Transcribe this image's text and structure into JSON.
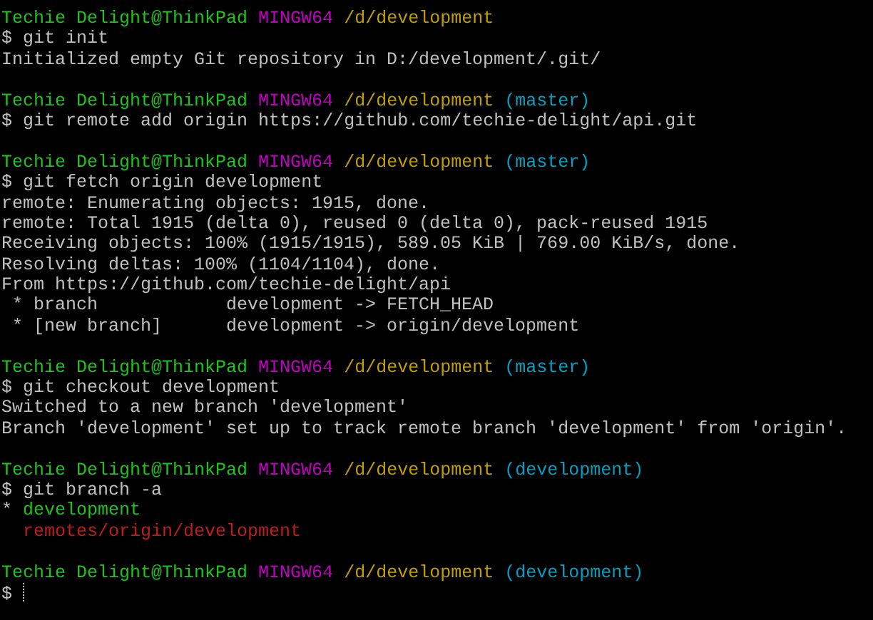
{
  "terminal": {
    "lines": [
      {
        "kind": "prompt",
        "user": "Techie Delight@ThinkPad",
        "shell": "MINGW64",
        "path": "/d/development"
      },
      {
        "kind": "command",
        "symbol": "$",
        "text": "git init"
      },
      {
        "kind": "output",
        "segments": [
          {
            "text": "Initialized empty Git repository in D:/development/.git/",
            "color": "#c0c0c0"
          }
        ]
      },
      {
        "kind": "blank"
      },
      {
        "kind": "prompt",
        "user": "Techie Delight@ThinkPad",
        "shell": "MINGW64",
        "path": "/d/development",
        "branch": "(master)"
      },
      {
        "kind": "command",
        "symbol": "$",
        "text": "git remote add origin https://github.com/techie-delight/api.git"
      },
      {
        "kind": "blank"
      },
      {
        "kind": "prompt",
        "user": "Techie Delight@ThinkPad",
        "shell": "MINGW64",
        "path": "/d/development",
        "branch": "(master)"
      },
      {
        "kind": "command",
        "symbol": "$",
        "text": "git fetch origin development"
      },
      {
        "kind": "output",
        "segments": [
          {
            "text": "remote: Enumerating objects: 1915, done.",
            "color": "#c0c0c0"
          }
        ]
      },
      {
        "kind": "output",
        "segments": [
          {
            "text": "remote: Total 1915 (delta 0), reused 0 (delta 0), pack-reused 1915",
            "color": "#c0c0c0"
          }
        ]
      },
      {
        "kind": "output",
        "segments": [
          {
            "text": "Receiving objects: 100% (1915/1915), 589.05 KiB | 769.00 KiB/s, done.",
            "color": "#c0c0c0"
          }
        ]
      },
      {
        "kind": "output",
        "segments": [
          {
            "text": "Resolving deltas: 100% (1104/1104), done.",
            "color": "#c0c0c0"
          }
        ]
      },
      {
        "kind": "output",
        "segments": [
          {
            "text": "From https://github.com/techie-delight/api",
            "color": "#c0c0c0"
          }
        ]
      },
      {
        "kind": "output",
        "segments": [
          {
            "text": " * branch            development -> FETCH_HEAD",
            "color": "#c0c0c0"
          }
        ]
      },
      {
        "kind": "output",
        "segments": [
          {
            "text": " * [new branch]      development -> origin/development",
            "color": "#c0c0c0"
          }
        ]
      },
      {
        "kind": "blank"
      },
      {
        "kind": "prompt",
        "user": "Techie Delight@ThinkPad",
        "shell": "MINGW64",
        "path": "/d/development",
        "branch": "(master)"
      },
      {
        "kind": "command",
        "symbol": "$",
        "text": "git checkout development"
      },
      {
        "kind": "output",
        "segments": [
          {
            "text": "Switched to a new branch 'development'",
            "color": "#c0c0c0"
          }
        ]
      },
      {
        "kind": "output",
        "segments": [
          {
            "text": "Branch 'development' set up to track remote branch 'development' from 'origin'.",
            "color": "#c0c0c0"
          }
        ]
      },
      {
        "kind": "blank"
      },
      {
        "kind": "prompt",
        "user": "Techie Delight@ThinkPad",
        "shell": "MINGW64",
        "path": "/d/development",
        "branch": "(development)"
      },
      {
        "kind": "command",
        "symbol": "$",
        "text": "git branch -a"
      },
      {
        "kind": "output",
        "segments": [
          {
            "text": "*",
            "color": "#c0c0c0"
          },
          {
            "text": "development",
            "color": "#1cc41c"
          }
        ]
      },
      {
        "kind": "output",
        "segments": [
          {
            "text": "  remotes/origin/development",
            "color": "#c01c1c"
          }
        ]
      },
      {
        "kind": "blank"
      },
      {
        "kind": "prompt",
        "user": "Techie Delight@ThinkPad",
        "shell": "MINGW64",
        "path": "/d/development",
        "branch": "(development)"
      },
      {
        "kind": "input",
        "symbol": "$"
      }
    ]
  }
}
